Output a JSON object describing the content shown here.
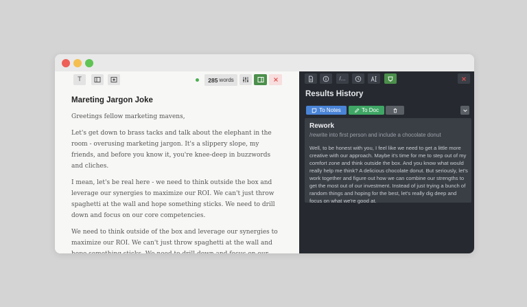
{
  "editor": {
    "toolbar": {
      "text_icon": "T",
      "word_count": "285",
      "word_unit": "words"
    },
    "document": {
      "title": "Mareting Jargon Joke",
      "paragraphs": [
        "Greetings fellow marketing mavens,",
        "Let's get down to brass tacks and talk about the elephant in the room - overusing marketing jargon. It's a slippery slope, my friends, and before you know it, you're knee-deep in buzzwords and cliches.",
        "I mean, let's be real here - we need to think outside the box and leverage our synergies to maximize our ROI. We can't just throw spaghetti at the wall and hope something sticks. We need to drill down and focus on our core competencies.",
        "We need to think outside of the box and leverage our synergies to maximize our ROI. We can't just throw spaghetti at the wall and hope something sticks. We need to drill down and focus on our core competencies."
      ]
    }
  },
  "results": {
    "toolbar_label_dots": "/...",
    "title": "Results History",
    "actions": {
      "to_notes": "To Notes",
      "to_doc": "To Doc"
    },
    "card": {
      "title": "Rework",
      "prompt": "/rewrite into first person and include a chocolate donut",
      "body": "Well, to be honest with you, I feel like we need to get a little more creative with our approach. Maybe it's time for me to step out of my comfort zone and think outside the box. And you know what would really help me think? A delicious chocolate donut. But seriously, let's work together and figure out how we can combine our strengths to get the most out of our investment. Instead of just trying a bunch of random things and hoping for the best, let's really dig deep and focus on what we're good at."
    }
  },
  "colors": {
    "accent_green": "#4b8f4b",
    "to_notes_blue": "#4a84d6",
    "to_doc_green": "#3fa665",
    "close_red": "#e05050"
  }
}
